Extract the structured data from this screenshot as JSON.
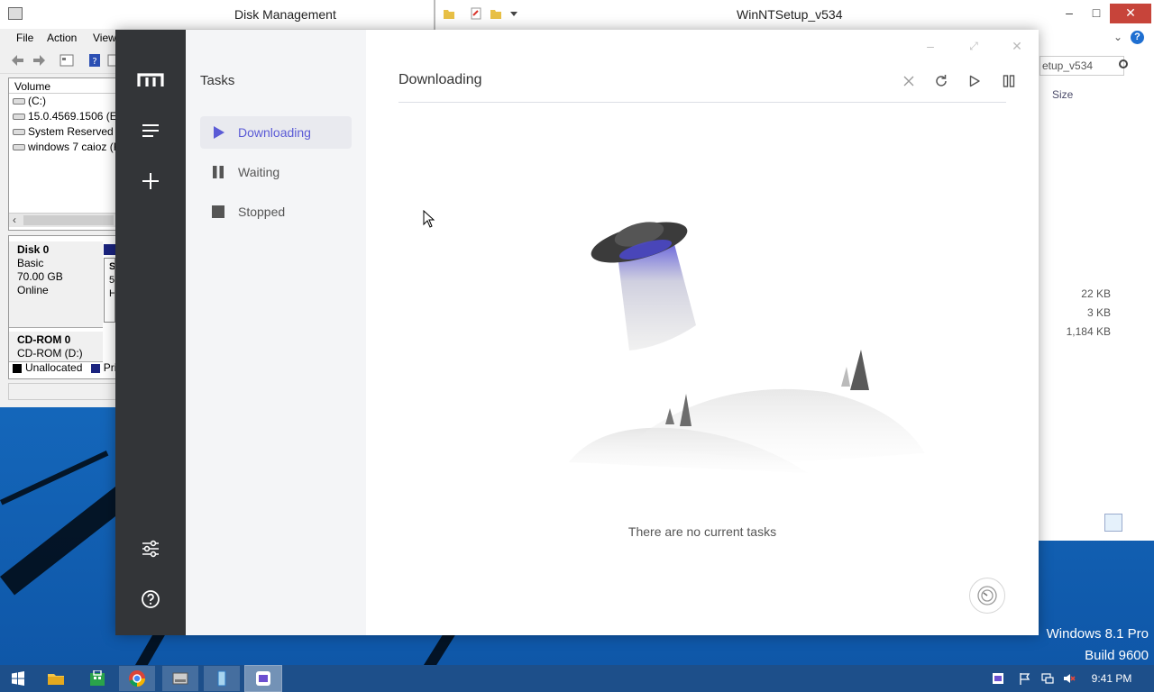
{
  "desktop": {
    "watermark_line1": "Windows 8.1 Pro",
    "watermark_line2": "Build 9600"
  },
  "disk_management": {
    "title": "Disk Management",
    "menu": [
      "File",
      "Action",
      "View"
    ],
    "volume_header": "Volume",
    "volumes": [
      "(C:)",
      "15.0.4569.1506 (E:)",
      "System Reserved",
      "windows 7 caioz (F:"
    ],
    "disk0": {
      "name": "Disk 0",
      "type": "Basic",
      "size": "70.00 GB",
      "status": "Online"
    },
    "cdrom": {
      "name": "CD-ROM 0",
      "drive": "CD-ROM (D:)"
    },
    "legend": {
      "unallocated": "Unallocated",
      "primary": "Pri"
    },
    "partition_letters": [
      "S",
      "5",
      "H"
    ]
  },
  "explorer": {
    "title": "WinNTSetup_v534",
    "search_placeholder": "etup_v534",
    "size_header": "Size",
    "sizes": [
      "22 KB",
      "3 KB",
      "1,184 KB"
    ],
    "minimize": "–",
    "maximize": "□",
    "close": "✕"
  },
  "motrix": {
    "section_title": "Tasks",
    "nav": [
      {
        "label": "Downloading",
        "icon": "play-icon",
        "active": true
      },
      {
        "label": "Waiting",
        "icon": "pause-icon",
        "active": false
      },
      {
        "label": "Stopped",
        "icon": "stop-icon",
        "active": false
      }
    ],
    "page_title": "Downloading",
    "empty_message": "There are no current tasks",
    "accent_color": "#5b5bd6"
  },
  "taskbar": {
    "clock": "9:41 PM"
  }
}
